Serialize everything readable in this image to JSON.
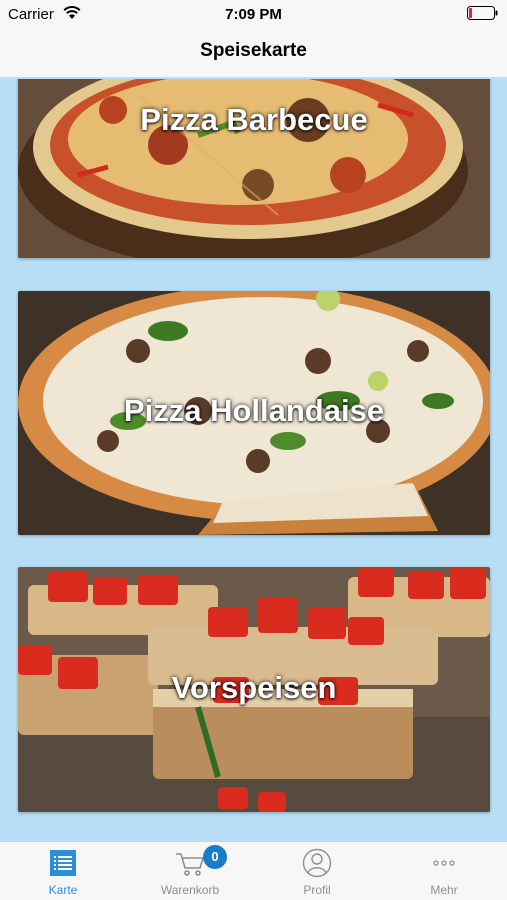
{
  "status_bar": {
    "carrier": "Carrier",
    "time": "7:09 PM"
  },
  "nav": {
    "title": "Speisekarte"
  },
  "menu": {
    "cards": [
      {
        "label": "Pizza Barbecue"
      },
      {
        "label": "Pizza Hollandaise"
      },
      {
        "label": "Vorspeisen"
      }
    ]
  },
  "tab_bar": {
    "tabs": [
      {
        "label": "Karte",
        "icon": "list-icon",
        "active": true
      },
      {
        "label": "Warenkorb",
        "icon": "cart-icon",
        "badge": "0"
      },
      {
        "label": "Profil",
        "icon": "profile-icon"
      },
      {
        "label": "Mehr",
        "icon": "more-icon"
      }
    ]
  },
  "colors": {
    "accent": "#2a8fd8",
    "background": "#b7def5",
    "badge": "#1a7cc9"
  }
}
